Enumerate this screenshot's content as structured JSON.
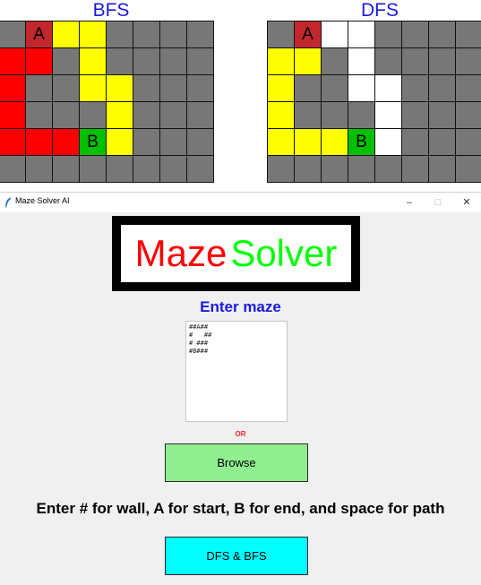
{
  "panels": [
    {
      "title": "BFS",
      "rows": [
        [
          {
            "c": "W",
            "t": ""
          },
          {
            "c": "A",
            "t": "A"
          },
          {
            "c": "Y",
            "t": ""
          },
          {
            "c": "Y",
            "t": ""
          },
          {
            "c": "W",
            "t": ""
          },
          {
            "c": "W",
            "t": ""
          },
          {
            "c": "W",
            "t": ""
          },
          {
            "c": "W",
            "t": ""
          }
        ],
        [
          {
            "c": "R",
            "t": ""
          },
          {
            "c": "R",
            "t": ""
          },
          {
            "c": "W",
            "t": ""
          },
          {
            "c": "Y",
            "t": ""
          },
          {
            "c": "W",
            "t": ""
          },
          {
            "c": "W",
            "t": ""
          },
          {
            "c": "W",
            "t": ""
          },
          {
            "c": "W",
            "t": ""
          }
        ],
        [
          {
            "c": "R",
            "t": ""
          },
          {
            "c": "W",
            "t": ""
          },
          {
            "c": "W",
            "t": ""
          },
          {
            "c": "Y",
            "t": ""
          },
          {
            "c": "Y",
            "t": ""
          },
          {
            "c": "W",
            "t": ""
          },
          {
            "c": "W",
            "t": ""
          },
          {
            "c": "W",
            "t": ""
          }
        ],
        [
          {
            "c": "R",
            "t": ""
          },
          {
            "c": "W",
            "t": ""
          },
          {
            "c": "W",
            "t": ""
          },
          {
            "c": "W",
            "t": ""
          },
          {
            "c": "Y",
            "t": ""
          },
          {
            "c": "W",
            "t": ""
          },
          {
            "c": "W",
            "t": ""
          },
          {
            "c": "W",
            "t": ""
          }
        ],
        [
          {
            "c": "R",
            "t": ""
          },
          {
            "c": "R",
            "t": ""
          },
          {
            "c": "R",
            "t": ""
          },
          {
            "c": "B",
            "t": "B"
          },
          {
            "c": "Y",
            "t": ""
          },
          {
            "c": "W",
            "t": ""
          },
          {
            "c": "W",
            "t": ""
          },
          {
            "c": "W",
            "t": ""
          }
        ],
        [
          {
            "c": "W",
            "t": ""
          },
          {
            "c": "W",
            "t": ""
          },
          {
            "c": "W",
            "t": ""
          },
          {
            "c": "W",
            "t": ""
          },
          {
            "c": "W",
            "t": ""
          },
          {
            "c": "W",
            "t": ""
          },
          {
            "c": "W",
            "t": ""
          },
          {
            "c": "W",
            "t": ""
          }
        ]
      ]
    },
    {
      "title": "DFS",
      "rows": [
        [
          {
            "c": "W",
            "t": ""
          },
          {
            "c": "A",
            "t": "A"
          },
          {
            "c": "E",
            "t": ""
          },
          {
            "c": "E",
            "t": ""
          },
          {
            "c": "W",
            "t": ""
          },
          {
            "c": "W",
            "t": ""
          },
          {
            "c": "W",
            "t": ""
          },
          {
            "c": "W",
            "t": ""
          }
        ],
        [
          {
            "c": "Y",
            "t": ""
          },
          {
            "c": "Y",
            "t": ""
          },
          {
            "c": "W",
            "t": ""
          },
          {
            "c": "E",
            "t": ""
          },
          {
            "c": "W",
            "t": ""
          },
          {
            "c": "W",
            "t": ""
          },
          {
            "c": "W",
            "t": ""
          },
          {
            "c": "W",
            "t": ""
          }
        ],
        [
          {
            "c": "Y",
            "t": ""
          },
          {
            "c": "W",
            "t": ""
          },
          {
            "c": "W",
            "t": ""
          },
          {
            "c": "E",
            "t": ""
          },
          {
            "c": "E",
            "t": ""
          },
          {
            "c": "W",
            "t": ""
          },
          {
            "c": "W",
            "t": ""
          },
          {
            "c": "W",
            "t": ""
          }
        ],
        [
          {
            "c": "Y",
            "t": ""
          },
          {
            "c": "W",
            "t": ""
          },
          {
            "c": "W",
            "t": ""
          },
          {
            "c": "W",
            "t": ""
          },
          {
            "c": "E",
            "t": ""
          },
          {
            "c": "W",
            "t": ""
          },
          {
            "c": "W",
            "t": ""
          },
          {
            "c": "W",
            "t": ""
          }
        ],
        [
          {
            "c": "Y",
            "t": ""
          },
          {
            "c": "Y",
            "t": ""
          },
          {
            "c": "Y",
            "t": ""
          },
          {
            "c": "B",
            "t": "B"
          },
          {
            "c": "E",
            "t": ""
          },
          {
            "c": "W",
            "t": ""
          },
          {
            "c": "W",
            "t": ""
          },
          {
            "c": "W",
            "t": ""
          }
        ],
        [
          {
            "c": "W",
            "t": ""
          },
          {
            "c": "W",
            "t": ""
          },
          {
            "c": "W",
            "t": ""
          },
          {
            "c": "W",
            "t": ""
          },
          {
            "c": "W",
            "t": ""
          },
          {
            "c": "W",
            "t": ""
          },
          {
            "c": "W",
            "t": ""
          },
          {
            "c": "W",
            "t": ""
          }
        ]
      ]
    }
  ],
  "window": {
    "title": "Maze Solver AI",
    "minimize": "–",
    "maximize": "□",
    "close": "✕",
    "icon": "feather-icon"
  },
  "logo": {
    "part1": "Maze",
    "part2": "Solver",
    "color1": "#ff0000",
    "color2": "#00ff00"
  },
  "form": {
    "enter_label": "Enter maze",
    "maze_text": "##A##\n#   ##\n# ###\n#B###",
    "or_label": "OR",
    "browse_label": "Browse",
    "hint": "Enter # for wall, A for start, B for end, and space for path",
    "solve_label": "DFS & BFS"
  },
  "colors": {
    "wall": "#777777",
    "start": "#c1272d",
    "end": "#00c000",
    "path": "#ffff00",
    "explored": "#ff0000",
    "open": "#ffffff",
    "browse_bg": "#90ee90",
    "solve_bg": "#00ffff",
    "accent": "#1a1ae0"
  }
}
